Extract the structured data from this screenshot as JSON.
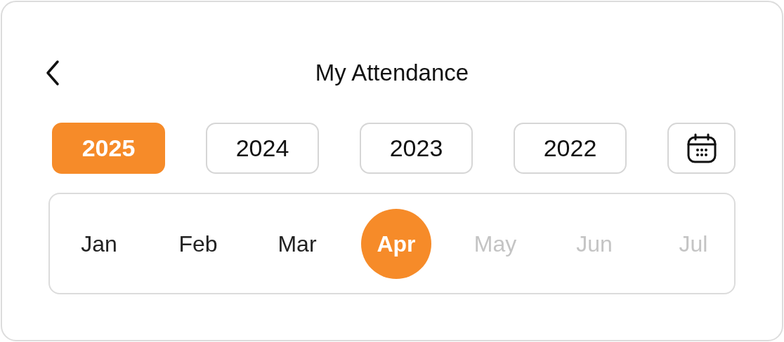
{
  "header": {
    "title": "My Attendance"
  },
  "years": [
    {
      "label": "2025",
      "selected": true
    },
    {
      "label": "2024",
      "selected": false
    },
    {
      "label": "2023",
      "selected": false
    },
    {
      "label": "2022",
      "selected": false
    }
  ],
  "months": [
    {
      "label": "Jan",
      "selected": false,
      "disabled": false
    },
    {
      "label": "Feb",
      "selected": false,
      "disabled": false
    },
    {
      "label": "Mar",
      "selected": false,
      "disabled": false
    },
    {
      "label": "Apr",
      "selected": true,
      "disabled": false
    },
    {
      "label": "May",
      "selected": false,
      "disabled": true
    },
    {
      "label": "Jun",
      "selected": false,
      "disabled": true
    },
    {
      "label": "Jul",
      "selected": false,
      "disabled": true
    }
  ]
}
